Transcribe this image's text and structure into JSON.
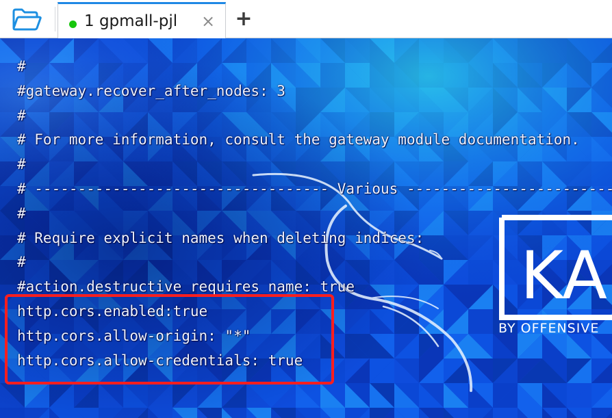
{
  "toolbar": {
    "open_icon": "folder-open-icon"
  },
  "tabs": [
    {
      "label": "1 gpmall-pjl",
      "status_color": "#16c60c",
      "close_glyph": "×",
      "active": true
    }
  ],
  "add_tab_glyph": "+",
  "terminal": {
    "lines": [
      "#",
      "#gateway.recover_after_nodes: 3",
      "#",
      "# For more information, consult the gateway module documentation.",
      "#",
      "# ---------------------------------- Various -----------------------------------",
      "#",
      "# Require explicit names when deleting indices:",
      "#",
      "#action.destructive_requires_name: true",
      "http.cors.enabled:true",
      "http.cors.allow-origin: \"*\"",
      "http.cors.allow-credentials: true"
    ],
    "highlight_color": "#ff1e1e",
    "wallpaper": {
      "logo_text": "KA",
      "tagline": "BY OFFENSIVE"
    }
  },
  "colors": {
    "accent": "#1e88e5",
    "terminal_text": "#eef2ff",
    "background": "#0b3fd0"
  }
}
